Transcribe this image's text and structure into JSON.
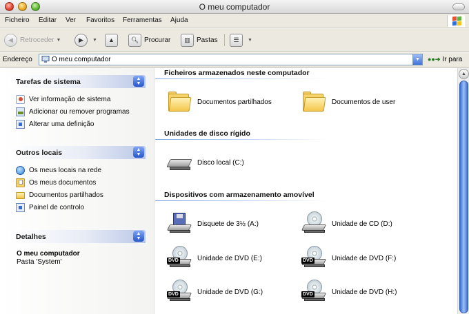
{
  "window": {
    "title": "O meu computador"
  },
  "menu": {
    "items": [
      "Ficheiro",
      "Editar",
      "Ver",
      "Favoritos",
      "Ferramentas",
      "Ajuda"
    ]
  },
  "toolbar": {
    "back_label": "Retroceder",
    "search_label": "Procurar",
    "folders_label": "Pastas"
  },
  "address": {
    "label": "Endereço",
    "value": "O meu computador",
    "go_label": "Ir para"
  },
  "sidebar": {
    "system_tasks": {
      "title": "Tarefas de sistema",
      "items": [
        "Ver informação de sistema",
        "Adicionar ou remover programas",
        "Alterar uma definição"
      ]
    },
    "other_places": {
      "title": "Outros locais",
      "items": [
        "Os meus locais na rede",
        "Os meus documentos",
        "Documentos partilhados",
        "Painel de controlo"
      ]
    },
    "details": {
      "title": "Detalhes",
      "name": "O meu computador",
      "subtitle": "Pasta 'System'"
    }
  },
  "main": {
    "groups": [
      {
        "title": "Ficheiros armazenados neste computador",
        "items": [
          "Documentos partilhados",
          "Documentos de user"
        ]
      },
      {
        "title": "Unidades de disco rígido",
        "items": [
          "Disco local (C:)"
        ]
      },
      {
        "title": "Dispositivos com armazenamento amovível",
        "items": [
          "Disquete de 3½ (A:)",
          "Unidade de CD (D:)",
          "Unidade de DVD (E:)",
          "Unidade de DVD (F:)",
          "Unidade de DVD (G:)",
          "Unidade de DVD (H:)"
        ]
      }
    ],
    "dvd_badge": "DVD"
  },
  "icons": {
    "folder": "folder-icon",
    "hard_drive": "hard-drive-icon",
    "floppy": "floppy-drive-icon",
    "cd": "cd-drive-icon",
    "dvd": "dvd-drive-icon"
  },
  "colors": {
    "accent": "#2756c8",
    "sidebar_header": "#b9c7e7",
    "folder": "#f6d26a"
  }
}
